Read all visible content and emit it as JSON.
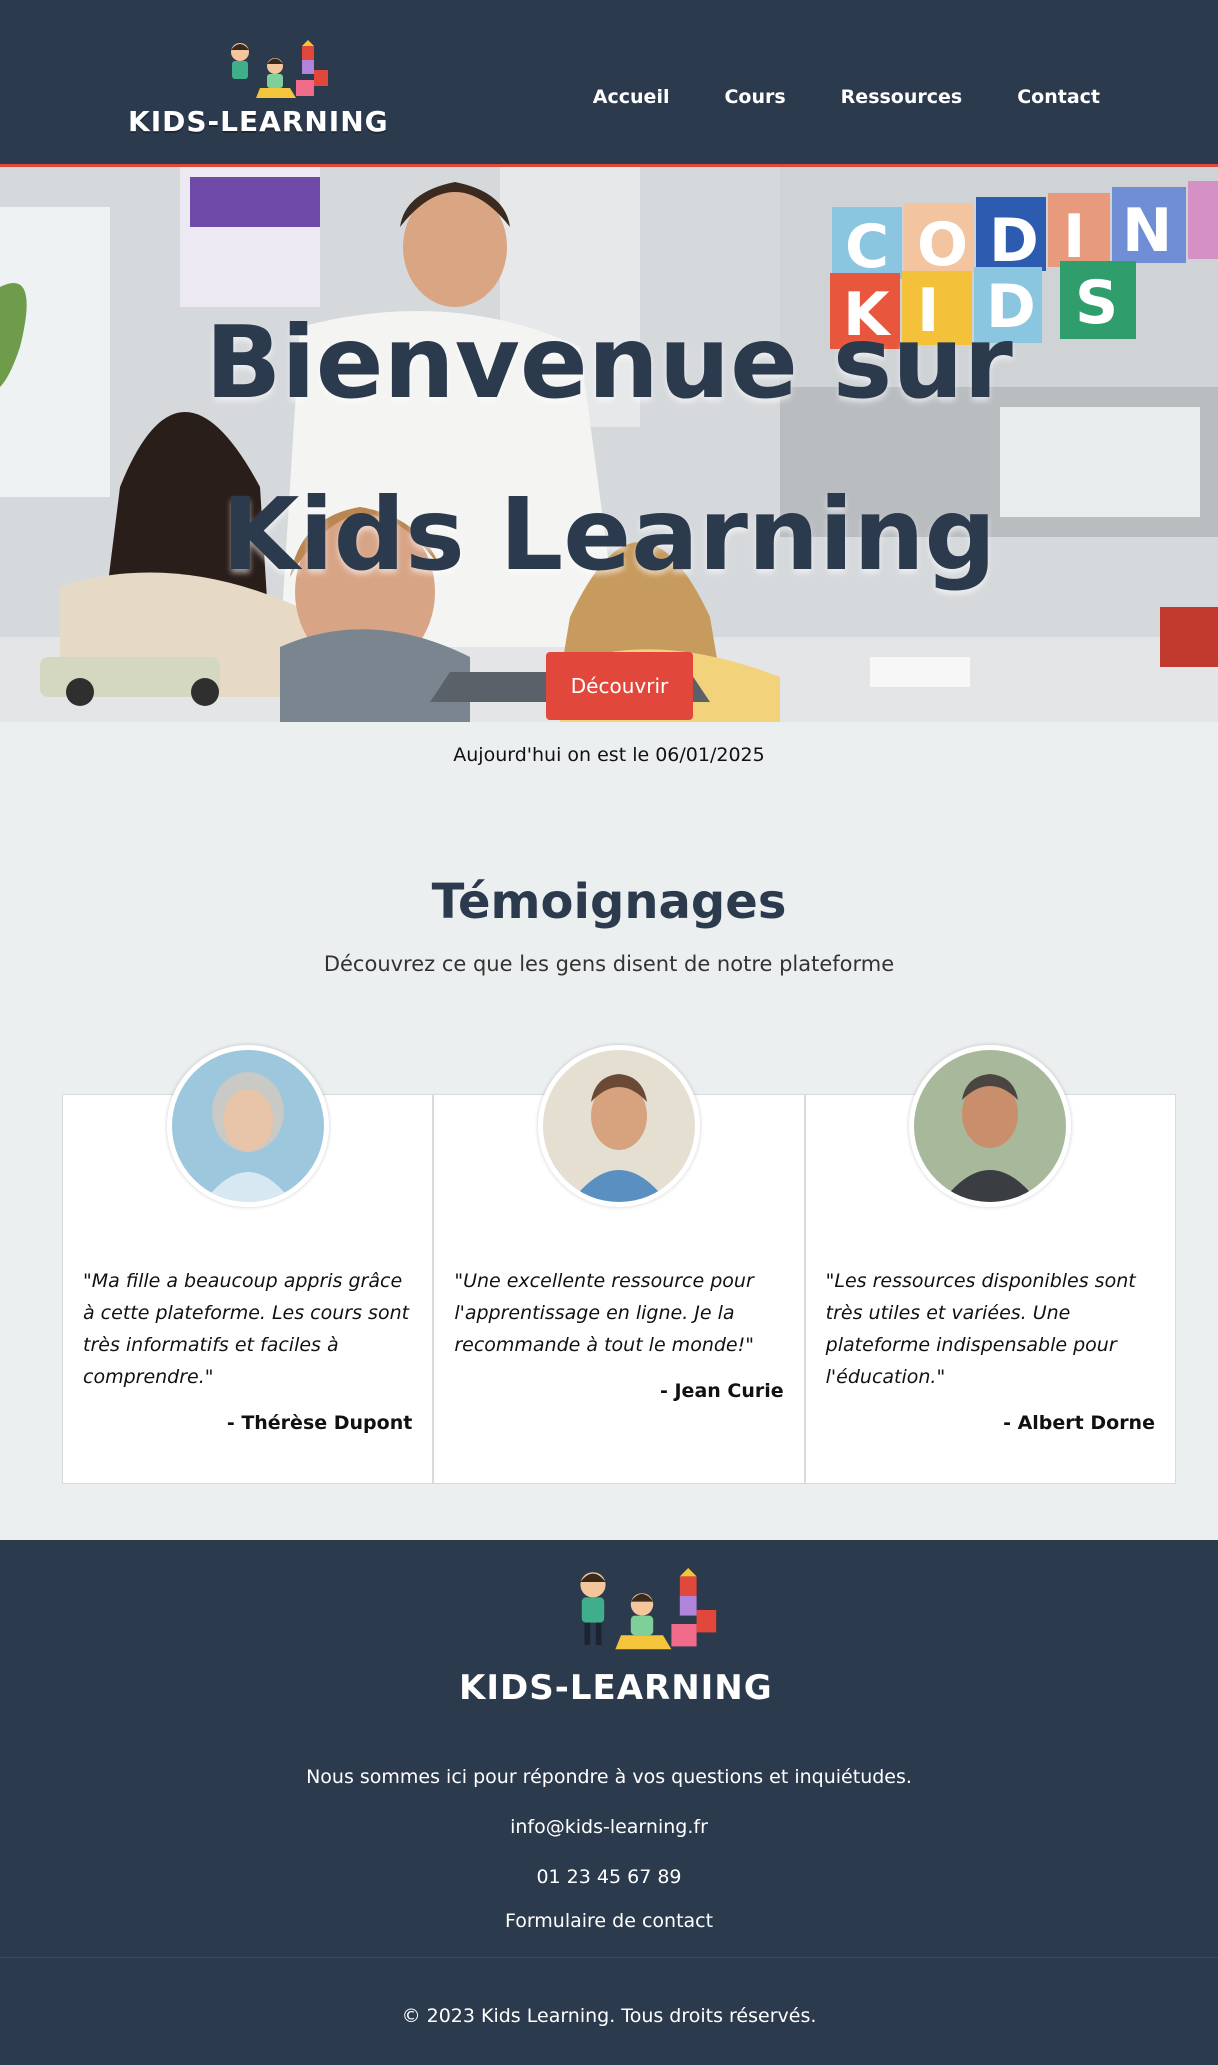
{
  "header": {
    "logo_text": "KIDS-LEARNING",
    "nav": [
      "Accueil",
      "Cours",
      "Ressources",
      "Contact"
    ]
  },
  "hero": {
    "title": "Bienvenue sur Kids Learning",
    "cta_label": "Découvrir",
    "board_letters": "CODING KIDS"
  },
  "date_text": "Aujourd'hui on est le 06/01/2025",
  "testimonials": {
    "title": "Témoignages",
    "subtitle": "Découvrez ce que les gens disent de notre plateforme",
    "items": [
      {
        "quote": "\"Ma fille a beaucoup appris grâce à cette plateforme. Les cours sont très informatifs et faciles à comprendre.\"",
        "author": "- Thérèse Dupont"
      },
      {
        "quote": "\"Une excellente ressource pour l'apprentissage en ligne. Je la recommande à tout le monde!\"",
        "author": "- Jean Curie"
      },
      {
        "quote": "\"Les ressources disponibles sont très utiles et variées. Une plateforme indispensable pour l'éducation.\"",
        "author": "- Albert Dorne"
      }
    ]
  },
  "footer": {
    "logo_text": "KIDS-LEARNING",
    "tagline": "Nous sommes ici pour répondre à vos questions et inquiétudes.",
    "email": "info@kids-learning.fr",
    "phone": "01 23 45 67 89",
    "form_link": "Formulaire de contact",
    "copyright": "© 2023 Kids Learning. Tous droits réservés."
  },
  "colors": {
    "navy": "#2c3a4d",
    "accent_red": "#e2473b",
    "page_bg": "#eceff0"
  }
}
